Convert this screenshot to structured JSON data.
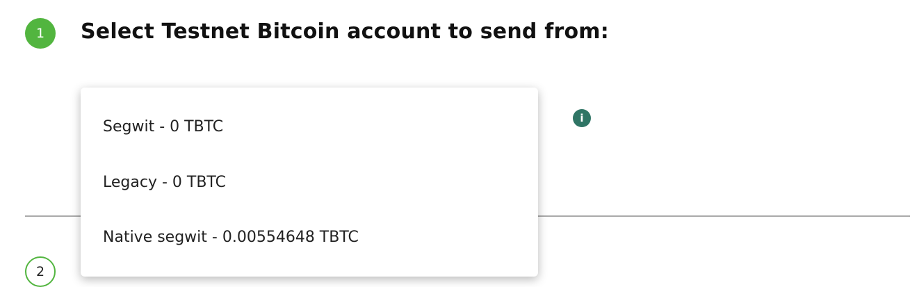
{
  "step1": {
    "number": "1",
    "title": "Select Testnet Bitcoin account to send from:"
  },
  "step2": {
    "number": "2"
  },
  "info_icon": "info-icon",
  "dropdown": {
    "options": [
      {
        "label": "Segwit - 0 TBTC"
      },
      {
        "label": "Legacy - 0 TBTC"
      },
      {
        "label": "Native segwit - 0.00554648 TBTC"
      }
    ]
  },
  "colors": {
    "accent": "#52b53f",
    "info": "#2f7565"
  }
}
